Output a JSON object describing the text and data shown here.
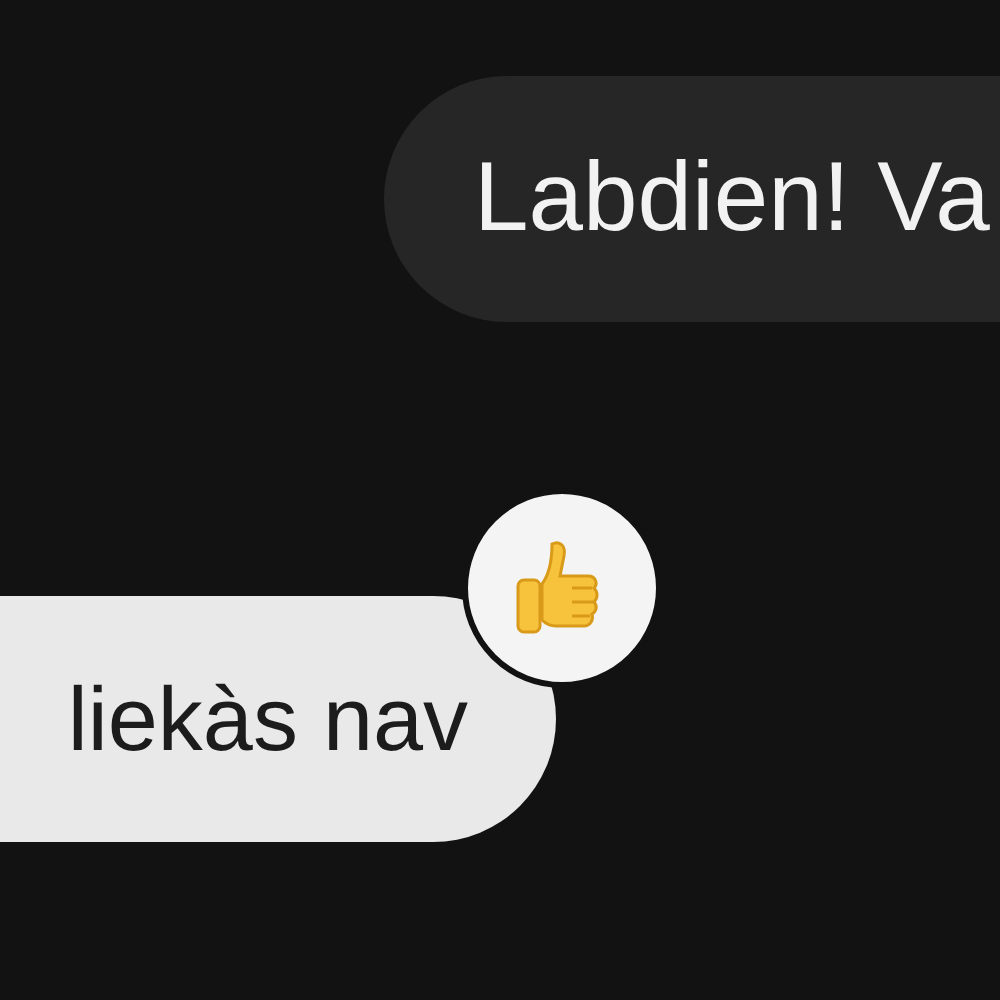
{
  "messages": [
    {
      "kind": "outgoing",
      "text": "Labdien! Va"
    },
    {
      "kind": "incoming",
      "text": "liekàs nav",
      "reaction": {
        "kind": "thumbs-up"
      }
    }
  ]
}
